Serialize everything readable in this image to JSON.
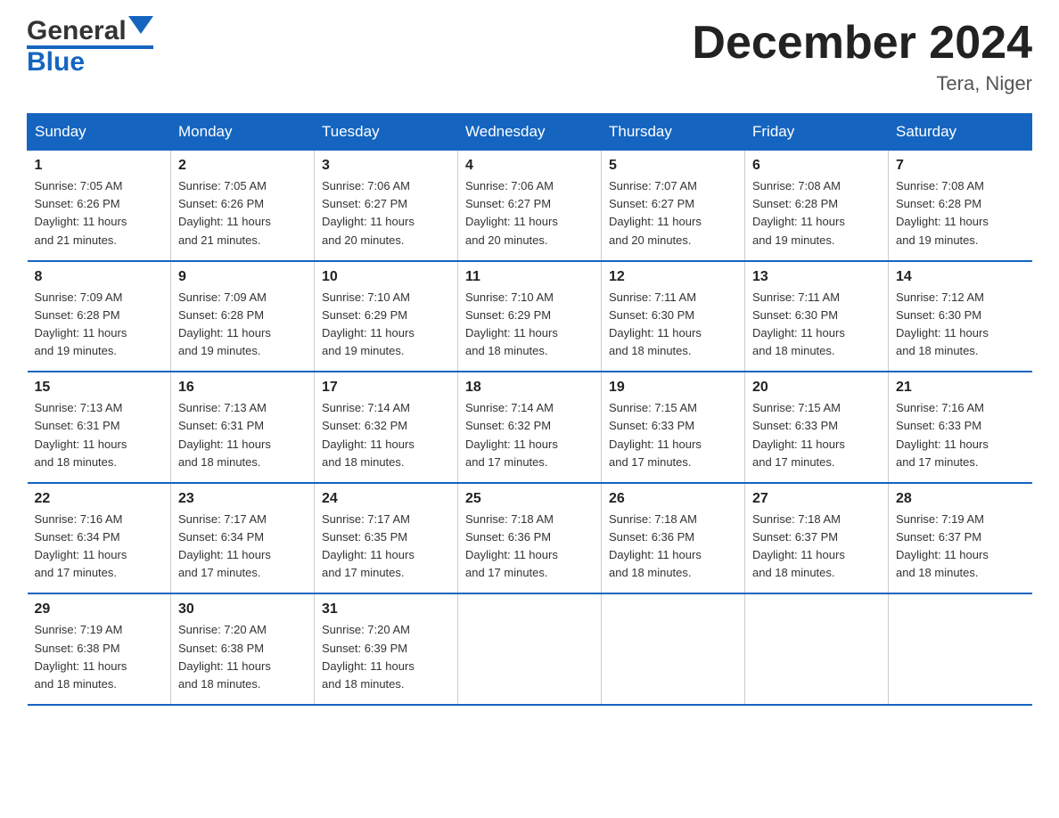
{
  "header": {
    "logo_general": "General",
    "logo_blue": "Blue",
    "month_title": "December 2024",
    "location": "Tera, Niger"
  },
  "days_of_week": [
    "Sunday",
    "Monday",
    "Tuesday",
    "Wednesday",
    "Thursday",
    "Friday",
    "Saturday"
  ],
  "weeks": [
    [
      {
        "day": "1",
        "sunrise": "7:05 AM",
        "sunset": "6:26 PM",
        "daylight": "11 hours and 21 minutes."
      },
      {
        "day": "2",
        "sunrise": "7:05 AM",
        "sunset": "6:26 PM",
        "daylight": "11 hours and 21 minutes."
      },
      {
        "day": "3",
        "sunrise": "7:06 AM",
        "sunset": "6:27 PM",
        "daylight": "11 hours and 20 minutes."
      },
      {
        "day": "4",
        "sunrise": "7:06 AM",
        "sunset": "6:27 PM",
        "daylight": "11 hours and 20 minutes."
      },
      {
        "day": "5",
        "sunrise": "7:07 AM",
        "sunset": "6:27 PM",
        "daylight": "11 hours and 20 minutes."
      },
      {
        "day": "6",
        "sunrise": "7:08 AM",
        "sunset": "6:28 PM",
        "daylight": "11 hours and 19 minutes."
      },
      {
        "day": "7",
        "sunrise": "7:08 AM",
        "sunset": "6:28 PM",
        "daylight": "11 hours and 19 minutes."
      }
    ],
    [
      {
        "day": "8",
        "sunrise": "7:09 AM",
        "sunset": "6:28 PM",
        "daylight": "11 hours and 19 minutes."
      },
      {
        "day": "9",
        "sunrise": "7:09 AM",
        "sunset": "6:28 PM",
        "daylight": "11 hours and 19 minutes."
      },
      {
        "day": "10",
        "sunrise": "7:10 AM",
        "sunset": "6:29 PM",
        "daylight": "11 hours and 19 minutes."
      },
      {
        "day": "11",
        "sunrise": "7:10 AM",
        "sunset": "6:29 PM",
        "daylight": "11 hours and 18 minutes."
      },
      {
        "day": "12",
        "sunrise": "7:11 AM",
        "sunset": "6:30 PM",
        "daylight": "11 hours and 18 minutes."
      },
      {
        "day": "13",
        "sunrise": "7:11 AM",
        "sunset": "6:30 PM",
        "daylight": "11 hours and 18 minutes."
      },
      {
        "day": "14",
        "sunrise": "7:12 AM",
        "sunset": "6:30 PM",
        "daylight": "11 hours and 18 minutes."
      }
    ],
    [
      {
        "day": "15",
        "sunrise": "7:13 AM",
        "sunset": "6:31 PM",
        "daylight": "11 hours and 18 minutes."
      },
      {
        "day": "16",
        "sunrise": "7:13 AM",
        "sunset": "6:31 PM",
        "daylight": "11 hours and 18 minutes."
      },
      {
        "day": "17",
        "sunrise": "7:14 AM",
        "sunset": "6:32 PM",
        "daylight": "11 hours and 18 minutes."
      },
      {
        "day": "18",
        "sunrise": "7:14 AM",
        "sunset": "6:32 PM",
        "daylight": "11 hours and 17 minutes."
      },
      {
        "day": "19",
        "sunrise": "7:15 AM",
        "sunset": "6:33 PM",
        "daylight": "11 hours and 17 minutes."
      },
      {
        "day": "20",
        "sunrise": "7:15 AM",
        "sunset": "6:33 PM",
        "daylight": "11 hours and 17 minutes."
      },
      {
        "day": "21",
        "sunrise": "7:16 AM",
        "sunset": "6:33 PM",
        "daylight": "11 hours and 17 minutes."
      }
    ],
    [
      {
        "day": "22",
        "sunrise": "7:16 AM",
        "sunset": "6:34 PM",
        "daylight": "11 hours and 17 minutes."
      },
      {
        "day": "23",
        "sunrise": "7:17 AM",
        "sunset": "6:34 PM",
        "daylight": "11 hours and 17 minutes."
      },
      {
        "day": "24",
        "sunrise": "7:17 AM",
        "sunset": "6:35 PM",
        "daylight": "11 hours and 17 minutes."
      },
      {
        "day": "25",
        "sunrise": "7:18 AM",
        "sunset": "6:36 PM",
        "daylight": "11 hours and 17 minutes."
      },
      {
        "day": "26",
        "sunrise": "7:18 AM",
        "sunset": "6:36 PM",
        "daylight": "11 hours and 18 minutes."
      },
      {
        "day": "27",
        "sunrise": "7:18 AM",
        "sunset": "6:37 PM",
        "daylight": "11 hours and 18 minutes."
      },
      {
        "day": "28",
        "sunrise": "7:19 AM",
        "sunset": "6:37 PM",
        "daylight": "11 hours and 18 minutes."
      }
    ],
    [
      {
        "day": "29",
        "sunrise": "7:19 AM",
        "sunset": "6:38 PM",
        "daylight": "11 hours and 18 minutes."
      },
      {
        "day": "30",
        "sunrise": "7:20 AM",
        "sunset": "6:38 PM",
        "daylight": "11 hours and 18 minutes."
      },
      {
        "day": "31",
        "sunrise": "7:20 AM",
        "sunset": "6:39 PM",
        "daylight": "11 hours and 18 minutes."
      },
      null,
      null,
      null,
      null
    ]
  ],
  "labels": {
    "sunrise": "Sunrise:",
    "sunset": "Sunset:",
    "daylight": "Daylight:"
  }
}
